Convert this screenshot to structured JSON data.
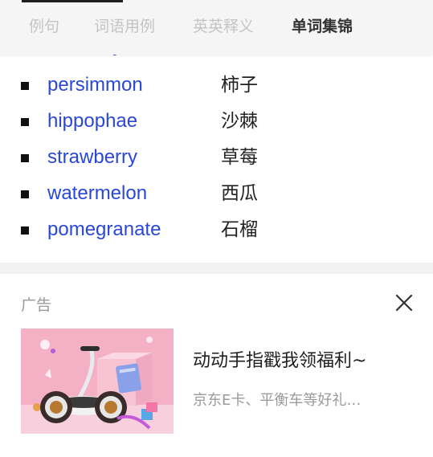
{
  "tabs": [
    {
      "label": "例句",
      "active": false
    },
    {
      "label": "词语用例",
      "active": false
    },
    {
      "label": "英英释义",
      "active": false
    },
    {
      "label": "单词集锦",
      "active": true
    }
  ],
  "wordlist": {
    "partial_top": {
      "en": "mulberry",
      "zh": "桑椹"
    },
    "items": [
      {
        "en": "persimmon",
        "zh": "柿子"
      },
      {
        "en": "hippophae",
        "zh": "沙棘"
      },
      {
        "en": "strawberry",
        "zh": "草莓"
      },
      {
        "en": "watermelon",
        "zh": "西瓜"
      },
      {
        "en": "pomegranate",
        "zh": "石榴"
      }
    ]
  },
  "ad": {
    "label": "广告",
    "title": "动动手指戳我领福利~",
    "subtitle": "京东E卡、平衡车等好礼…",
    "close_icon": "close-icon",
    "image_icon": "balance-scooter-illustration"
  },
  "colors": {
    "link": "#2a47d6",
    "tab_inactive": "#c4c4c4",
    "tab_active": "#333333",
    "ad_image_bg": "#f2a2bf"
  }
}
